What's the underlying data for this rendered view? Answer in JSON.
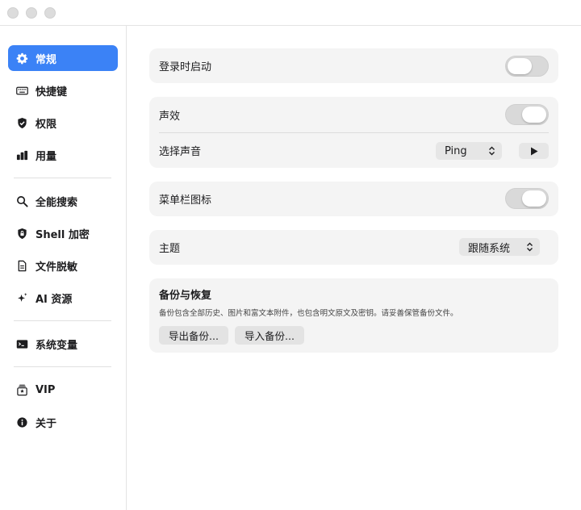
{
  "window": {
    "controls": [
      "close",
      "minimize",
      "zoom"
    ]
  },
  "sidebar": {
    "items": [
      {
        "label": "常规",
        "icon": "gear-icon",
        "active": true
      },
      {
        "label": "快捷键",
        "icon": "keyboard-icon"
      },
      {
        "label": "权限",
        "icon": "shield-check-icon"
      },
      {
        "label": "用量",
        "icon": "bar-chart-icon"
      },
      {
        "label": "全能搜索",
        "icon": "search-icon"
      },
      {
        "label": "Shell 加密",
        "icon": "lock-shield-icon"
      },
      {
        "label": "文件脱敏",
        "icon": "document-icon"
      },
      {
        "label": "AI 资源",
        "icon": "sparkle-icon"
      },
      {
        "label": "系统变量",
        "icon": "terminal-icon"
      },
      {
        "label": "VIP",
        "icon": "vip-icon"
      },
      {
        "label": "关于",
        "icon": "info-icon"
      }
    ],
    "accent": "#3b82f6"
  },
  "settings": {
    "launch_at_login": {
      "label": "登录时启动",
      "enabled": false
    },
    "sound_effects": {
      "label": "声效",
      "enabled": true
    },
    "choose_sound": {
      "label": "选择声音",
      "value": "Ping"
    },
    "menubar_icon": {
      "label": "菜单栏图标",
      "enabled": true
    },
    "theme": {
      "label": "主题",
      "value": "跟随系统"
    },
    "backup": {
      "title": "备份与恢复",
      "description": "备份包含全部历史、图片和富文本附件，也包含明文原文及密钥。请妥善保管备份文件。",
      "export_label": "导出备份...",
      "import_label": "导入备份..."
    }
  }
}
